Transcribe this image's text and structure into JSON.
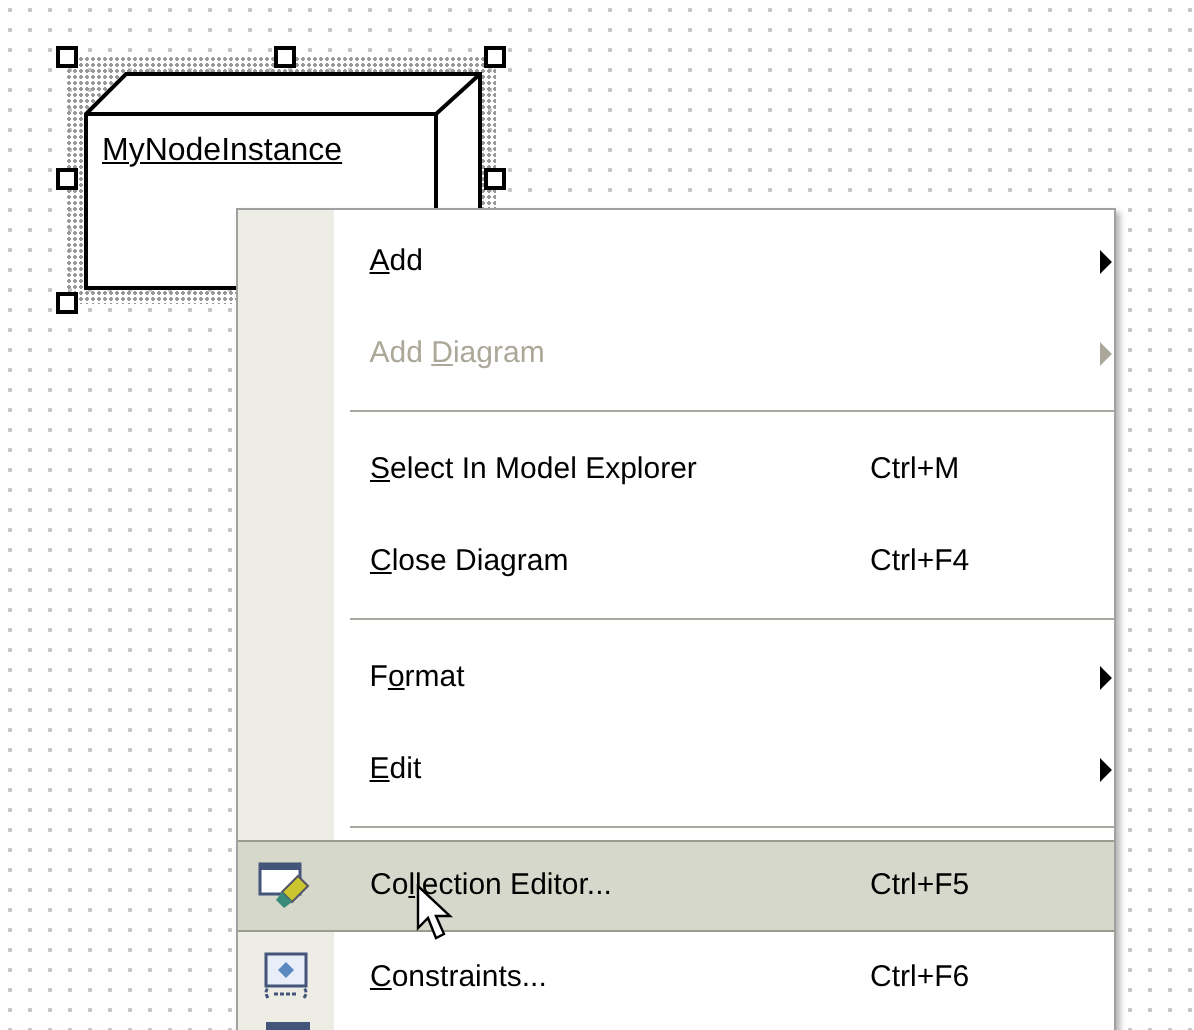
{
  "node": {
    "name": "MyNodeInstance",
    "selected": true
  },
  "context_menu": {
    "items": [
      {
        "kind": "item",
        "label": {
          "key": "A",
          "after": "dd"
        },
        "submenu": true,
        "disabled": false,
        "selected": false,
        "has_icon": false
      },
      {
        "kind": "item",
        "label": {
          "before": "Add ",
          "key": "D",
          "after": "iagram"
        },
        "submenu": true,
        "disabled": true,
        "selected": false,
        "has_icon": false
      },
      {
        "kind": "separator"
      },
      {
        "kind": "item",
        "label": {
          "key": "S",
          "after": "elect In Model Explorer"
        },
        "shortcut": "Ctrl+M",
        "submenu": false,
        "disabled": false,
        "selected": false,
        "has_icon": false
      },
      {
        "kind": "item",
        "label": {
          "key": "C",
          "after": "lose Diagram"
        },
        "shortcut": "Ctrl+F4",
        "submenu": false,
        "disabled": false,
        "selected": false,
        "has_icon": false
      },
      {
        "kind": "separator"
      },
      {
        "kind": "item",
        "label": {
          "before": "F",
          "key": "o",
          "after": "rmat"
        },
        "submenu": true,
        "disabled": false,
        "selected": false,
        "has_icon": false
      },
      {
        "kind": "item",
        "label": {
          "key": "E",
          "after": "dit"
        },
        "submenu": true,
        "disabled": false,
        "selected": false,
        "has_icon": false
      },
      {
        "kind": "separator"
      },
      {
        "kind": "item",
        "label": {
          "before": "Co",
          "key": "l",
          "after": "lection Editor..."
        },
        "shortcut": "Ctrl+F5",
        "submenu": false,
        "disabled": false,
        "selected": true,
        "has_icon": true
      },
      {
        "kind": "item",
        "label": {
          "key": "C",
          "after": "onstraints..."
        },
        "shortcut": "Ctrl+F6",
        "submenu": false,
        "disabled": false,
        "selected": false,
        "has_icon": true
      }
    ]
  }
}
